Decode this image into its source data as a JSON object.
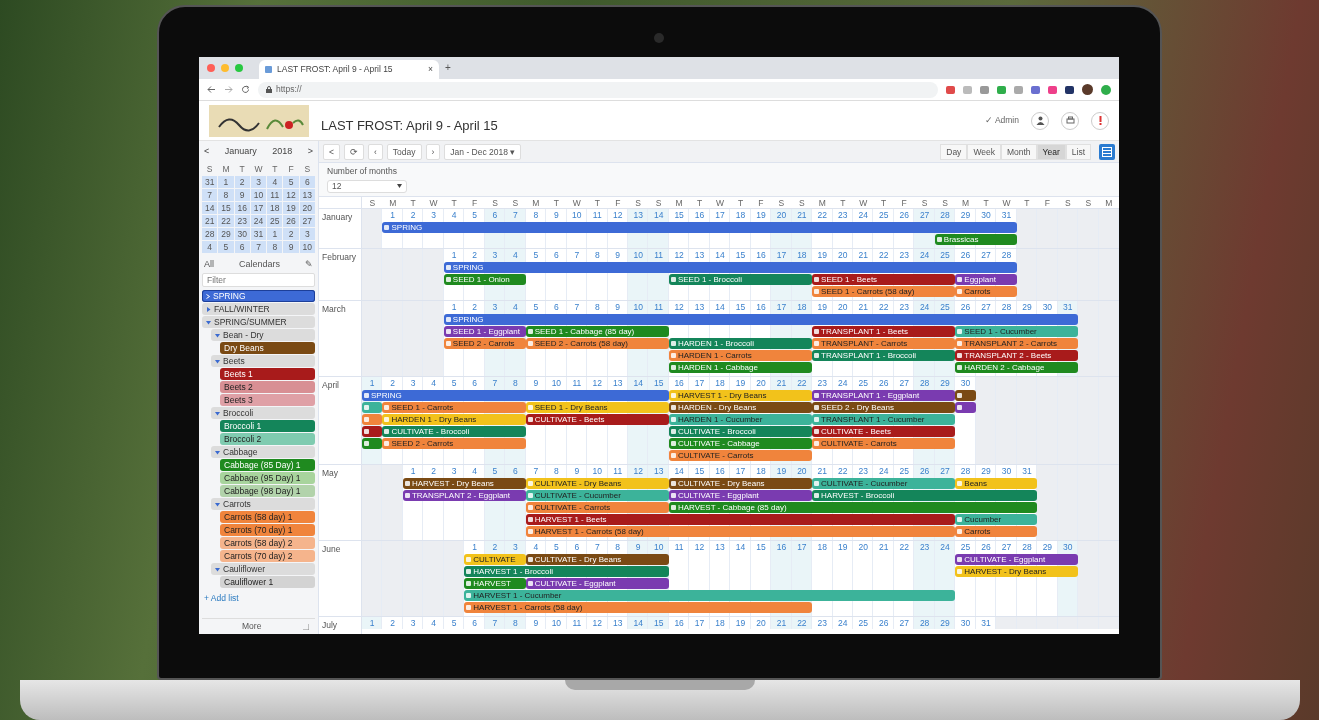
{
  "browser": {
    "tab_title": "LAST FROST: April 9 - April 15",
    "tab_close": "×",
    "new_tab": "+",
    "url": "https://"
  },
  "header": {
    "title": "LAST FROST: April 9 - April 15",
    "user": "✓ Admin"
  },
  "mini_calendar": {
    "prev": "<",
    "month": "January",
    "year": "2018",
    "next": ">",
    "weekdays": [
      "S",
      "M",
      "T",
      "W",
      "T",
      "F",
      "S"
    ],
    "weeks": [
      [
        "31",
        "1",
        "2",
        "3",
        "4",
        "5",
        "6"
      ],
      [
        "7",
        "8",
        "9",
        "10",
        "11",
        "12",
        "13"
      ],
      [
        "14",
        "15",
        "16",
        "17",
        "18",
        "19",
        "20"
      ],
      [
        "21",
        "22",
        "23",
        "24",
        "25",
        "26",
        "27"
      ],
      [
        "28",
        "29",
        "30",
        "31",
        "1",
        "2",
        "3"
      ],
      [
        "4",
        "5",
        "6",
        "7",
        "8",
        "9",
        "10"
      ]
    ]
  },
  "toolbar": {
    "prev": "<",
    "refresh": "⟳",
    "back": "‹",
    "today": "Today",
    "forward": "›",
    "range": "Jan - Dec 2018 ▾",
    "views": [
      {
        "label": "Day",
        "selected": false
      },
      {
        "label": "Week",
        "selected": false
      },
      {
        "label": "Month",
        "selected": false
      },
      {
        "label": "Year",
        "selected": true
      },
      {
        "label": "List",
        "selected": false
      }
    ]
  },
  "calendars": {
    "all": "All",
    "title": "Calendars",
    "edit": "✎",
    "filter_placeholder": "Filter",
    "items": [
      {
        "label": "SPRING",
        "color": "#3d6ad6",
        "selected": true
      },
      {
        "label": "FALL/WINTER",
        "expanded": false
      },
      {
        "label": "SPRING/SUMMER",
        "expanded": true,
        "children": [
          {
            "label": "Bean - Dry",
            "expanded": true,
            "children": [
              {
                "label": "Dry Beans",
                "color": "#7a4a14",
                "selected": false
              }
            ]
          },
          {
            "label": "Beets",
            "expanded": true,
            "children": [
              {
                "label": "Beets 1",
                "color": "#a81b1b",
                "selected": false
              },
              {
                "label": "Beets 2",
                "color": "#d88f94",
                "selected": false
              },
              {
                "label": "Beets 3",
                "color": "#dfa0a6",
                "selected": false
              }
            ]
          },
          {
            "label": "Broccoli",
            "expanded": true,
            "children": [
              {
                "label": "Broccoli 1",
                "color": "#14855a",
                "selected": false
              },
              {
                "label": "Broccoli 2",
                "color": "#7fcbb0",
                "selected": false
              }
            ]
          },
          {
            "label": "Cabbage",
            "expanded": true,
            "children": [
              {
                "label": "Cabbage (85 Day) 1",
                "color": "#1f8a1f",
                "selected": false
              },
              {
                "label": "Cabbage (95 Day) 1",
                "color": "#a8d49d",
                "selected": false
              },
              {
                "label": "Cabbage (98 Day) 1",
                "color": "#b2d3ab",
                "selected": false
              }
            ]
          },
          {
            "label": "Carrots",
            "expanded": true,
            "children": [
              {
                "label": "Carrots (58 day) 1",
                "color": "#f0843c",
                "selected": false
              },
              {
                "label": "Carrots (70 day) 1",
                "color": "#f0843c",
                "selected": false
              },
              {
                "label": "Carrots (58 day) 2",
                "color": "#f5b48c",
                "selected": false
              },
              {
                "label": "Carrots (70 day) 2",
                "color": "#f5b48c",
                "selected": false
              }
            ]
          },
          {
            "label": "Cauliflower",
            "expanded": true,
            "children": [
              {
                "label": "Cauliflower 1",
                "color": "#d3d3d3",
                "selected": false
              }
            ]
          }
        ]
      }
    ],
    "add": "+ Add list",
    "more": "More"
  },
  "months_setting": {
    "label": "Number of months",
    "value": "12"
  },
  "grid": {
    "weekday_header": [
      "S",
      "M",
      "T",
      "W",
      "T",
      "F",
      "S",
      "S",
      "M",
      "T",
      "W",
      "T",
      "F",
      "S",
      "S",
      "M",
      "T",
      "W",
      "T",
      "F",
      "S",
      "S",
      "M",
      "T",
      "W",
      "T",
      "F",
      "S",
      "S",
      "M",
      "T",
      "W",
      "T",
      "F",
      "S",
      "S",
      "M"
    ],
    "months": [
      {
        "label": "January",
        "days": [
          "1",
          "2",
          "3",
          "4",
          "5",
          "6",
          "7",
          "8",
          "9",
          "10",
          "11",
          "12",
          "13",
          "14",
          "15",
          "16",
          "17",
          "18",
          "19",
          "20",
          "21",
          "22",
          "23",
          "24",
          "25",
          "26",
          "27",
          "28",
          "29",
          "30",
          "31"
        ],
        "lanes": [
          [
            {
              "label": "SPRING",
              "color": "#3d6ad6"
            }
          ],
          [
            {
              "label": "Brassicas",
              "color": "#1f8a1f"
            }
          ]
        ]
      },
      {
        "label": "February",
        "days": [
          "1",
          "2",
          "3",
          "4",
          "5",
          "6",
          "7",
          "8",
          "9",
          "10",
          "11",
          "12",
          "13",
          "14",
          "15",
          "16",
          "17",
          "18",
          "19",
          "20",
          "21",
          "22",
          "23",
          "24",
          "25",
          "26",
          "27",
          "28"
        ],
        "lanes": [
          [
            {
              "label": "SPRING",
              "color": "#3d6ad6"
            }
          ],
          [
            {
              "label": "SEED 1 - Onion",
              "color": "#1f8a1f"
            },
            {
              "label": "SEED 1 - Broccoli",
              "color": "#14855a"
            },
            {
              "label": "SEED 1 - Beets",
              "color": "#a81b1b"
            },
            {
              "label": "Eggplant",
              "color": "#7a3bb0"
            }
          ],
          [
            {
              "label": "SEED 1 - Carrots (58 day)",
              "color": "#f0843c"
            },
            {
              "label": "Carrots",
              "color": "#f0843c"
            }
          ]
        ]
      },
      {
        "label": "March",
        "days": [
          "1",
          "2",
          "3",
          "4",
          "5",
          "6",
          "7",
          "8",
          "9",
          "10",
          "11",
          "12",
          "13",
          "14",
          "15",
          "16",
          "17",
          "18",
          "19",
          "20",
          "21",
          "22",
          "23",
          "24",
          "25",
          "26",
          "27",
          "28",
          "29",
          "30",
          "31"
        ],
        "lanes": [
          [
            {
              "label": "SPRING",
              "color": "#3d6ad6"
            }
          ],
          [
            {
              "label": "SEED 1 - Eggplant",
              "color": "#7a3bb0"
            },
            {
              "label": "SEED 1 - Cabbage (85 day)",
              "color": "#1f8a1f"
            },
            {
              "label": "TRANSPLANT 1 - Beets",
              "color": "#a81b1b"
            },
            {
              "label": "SEED 1 - Cucumber",
              "color": "#3cb39a"
            }
          ],
          [
            {
              "label": "SEED 2 - Carrots",
              "color": "#f0843c"
            },
            {
              "label": "SEED 2 - Carrots (58 day)",
              "color": "#f0843c"
            },
            {
              "label": "HARDEN 1 - Broccoli",
              "color": "#14855a"
            },
            {
              "label": "TRANSPLANT - Carrots",
              "color": "#f0843c"
            },
            {
              "label": "TRANSPLANT 2 - Carrots",
              "color": "#f0843c"
            }
          ],
          [
            {
              "label": "HARDEN 1 - Carrots",
              "color": "#f0843c"
            },
            {
              "label": "TRANSPLANT 1 - Broccoli",
              "color": "#14855a"
            },
            {
              "label": "TRANSPLANT 2 - Beets",
              "color": "#a81b1b"
            }
          ],
          [
            {
              "label": "HARDEN 1 - Cabbage",
              "color": "#1f8a1f"
            },
            {
              "label": "HARDEN 2 - Cabbage",
              "color": "#1f8a1f"
            }
          ]
        ]
      },
      {
        "label": "April",
        "days": [
          "1",
          "2",
          "3",
          "4",
          "5",
          "6",
          "7",
          "8",
          "9",
          "10",
          "11",
          "12",
          "13",
          "14",
          "15",
          "16",
          "17",
          "18",
          "19",
          "20",
          "21",
          "22",
          "23",
          "24",
          "25",
          "26",
          "27",
          "28",
          "29",
          "30"
        ],
        "lanes": [
          [
            {
              "label": "SPRING",
              "color": "#3d6ad6"
            },
            {
              "label": "HARVEST 1 - Dry Beans",
              "color": "#f2c21b"
            },
            {
              "label": "TRANSPLANT 1 - Eggplant",
              "color": "#7a3bb0"
            },
            {
              "color": "#7a4a14"
            }
          ],
          [
            {
              "color": "#3cb39a"
            },
            {
              "label": "SEED 1 - Carrots",
              "color": "#f0843c"
            },
            {
              "label": "SEED 1 - Dry Beans",
              "color": "#f2c21b"
            },
            {
              "label": "HARDEN - Dry Beans",
              "color": "#7a4a14"
            },
            {
              "label": "SEED 2 - Dry Beans",
              "color": "#7a4a14"
            },
            {
              "color": "#7a3bb0"
            }
          ],
          [
            {
              "color": "#f0843c"
            },
            {
              "label": "HARDEN 1 - Dry Beans",
              "color": "#f2c21b"
            },
            {
              "label": "CULTIVATE - Beets",
              "color": "#a81b1b"
            },
            {
              "label": "HARDEN 1 - Cucumber",
              "color": "#3cb39a"
            },
            {
              "label": "TRANSPLANT 1 - Cucumber",
              "color": "#3cb39a"
            }
          ],
          [
            {
              "color": "#a81b1b"
            },
            {
              "label": "CULTIVATE - Broccoli",
              "color": "#14855a"
            },
            {
              "label": "CULTIVATE - Broccoli",
              "color": "#14855a"
            },
            {
              "label": "CULTIVATE - Beets",
              "color": "#a81b1b"
            }
          ],
          [
            {
              "color": "#1f8a1f"
            },
            {
              "label": "SEED 2 - Carrots",
              "color": "#f0843c"
            },
            {
              "label": "CULTIVATE - Cabbage",
              "color": "#1f8a1f"
            },
            {
              "label": "CULTIVATE - Carrots",
              "color": "#f0843c"
            }
          ],
          [
            {
              "label": "CULTIVATE - Carrots",
              "color": "#f0843c"
            }
          ]
        ]
      },
      {
        "label": "May",
        "days": [
          "1",
          "2",
          "3",
          "4",
          "5",
          "6",
          "7",
          "8",
          "9",
          "10",
          "11",
          "12",
          "13",
          "14",
          "15",
          "16",
          "17",
          "18",
          "19",
          "20",
          "21",
          "22",
          "23",
          "24",
          "25",
          "26",
          "27",
          "28",
          "29",
          "30",
          "31"
        ],
        "lanes": [
          [
            {
              "label": "HARVEST - Dry Beans",
              "color": "#7a4a14"
            },
            {
              "label": "CULTIVATE - Dry Beans",
              "color": "#f2c21b"
            },
            {
              "label": "CULTIVATE - Dry Beans",
              "color": "#7a4a14"
            },
            {
              "label": "CULTIVATE - Cucumber",
              "color": "#3cb39a"
            },
            {
              "label": "Beans",
              "color": "#f2c21b"
            }
          ],
          [
            {
              "label": "TRANSPLANT 2 - Eggplant",
              "color": "#7a3bb0"
            },
            {
              "label": "CULTIVATE - Cucumber",
              "color": "#3cb39a"
            },
            {
              "label": "CULTIVATE - Eggplant",
              "color": "#7a3bb0"
            },
            {
              "label": "HARVEST - Broccoli",
              "color": "#14855a"
            }
          ],
          [
            {
              "label": "CULTIVATE - Carrots",
              "color": "#f0843c"
            },
            {
              "label": "HARVEST - Cabbage (85 day)",
              "color": "#1f8a1f"
            }
          ],
          [
            {
              "label": "HARVEST 1 - Beets",
              "color": "#a81b1b"
            },
            {
              "label": "Cucumber",
              "color": "#3cb39a"
            }
          ],
          [
            {
              "label": "HARVEST 1 - Carrots (58 day)",
              "color": "#f0843c"
            },
            {
              "label": "Carrots",
              "color": "#f0843c"
            }
          ]
        ]
      },
      {
        "label": "June",
        "days": [
          "1",
          "2",
          "3",
          "4",
          "5",
          "6",
          "7",
          "8",
          "9",
          "10",
          "11",
          "12",
          "13",
          "14",
          "15",
          "16",
          "17",
          "18",
          "19",
          "20",
          "21",
          "22",
          "23",
          "24",
          "25",
          "26",
          "27",
          "28",
          "29",
          "30"
        ],
        "lanes": [
          [
            {
              "label": "CULTIVATE",
              "color": "#f2c21b"
            },
            {
              "label": "CULTIVATE - Dry Beans",
              "color": "#7a4a14"
            },
            {
              "label": "CULTIVATE - Eggplant",
              "color": "#7a3bb0"
            }
          ],
          [
            {
              "label": "HARVEST 1 - Broccoli",
              "color": "#14855a"
            },
            {
              "label": "HARVEST - Dry Beans",
              "color": "#f2c21b"
            }
          ],
          [
            {
              "label": "HARVEST",
              "color": "#1f8a1f"
            },
            {
              "label": "CULTIVATE - Eggplant",
              "color": "#7a3bb0"
            }
          ],
          [
            {
              "label": "HARVEST 1 - Cucumber",
              "color": "#3cb39a"
            }
          ],
          [
            {
              "label": "HARVEST 1 - Carrots (58 day)",
              "color": "#f0843c"
            }
          ]
        ]
      },
      {
        "label": "July",
        "days": [
          "1",
          "2",
          "3",
          "4",
          "5",
          "6",
          "7",
          "8",
          "9",
          "10",
          "11",
          "12",
          "13",
          "14",
          "15",
          "16",
          "17",
          "18",
          "19",
          "20",
          "21",
          "22",
          "23",
          "24",
          "25",
          "26",
          "27",
          "28",
          "29",
          "30",
          "31"
        ]
      }
    ]
  }
}
